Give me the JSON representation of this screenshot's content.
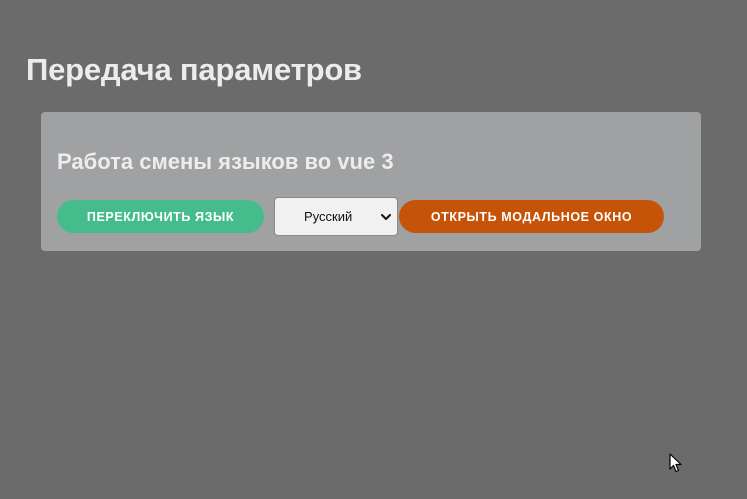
{
  "page": {
    "title": "Передача параметров"
  },
  "card": {
    "title": "Работа смены языков во vue 3",
    "switch_button_label": "ПЕРЕКЛЮЧИТЬ ЯЗЫК",
    "language_select": {
      "selected": "Русский"
    },
    "modal_button_label": "ОТКРЫТЬ МОДАЛЬНОЕ ОКНО"
  },
  "colors": {
    "background": "#6b6b6b",
    "card": "#a0a1a3",
    "switch_button": "#45bd8a",
    "modal_button": "#c55408"
  },
  "icons": {
    "select_arrow": "chevron-down-icon",
    "pointer": "mouse-cursor-icon"
  }
}
